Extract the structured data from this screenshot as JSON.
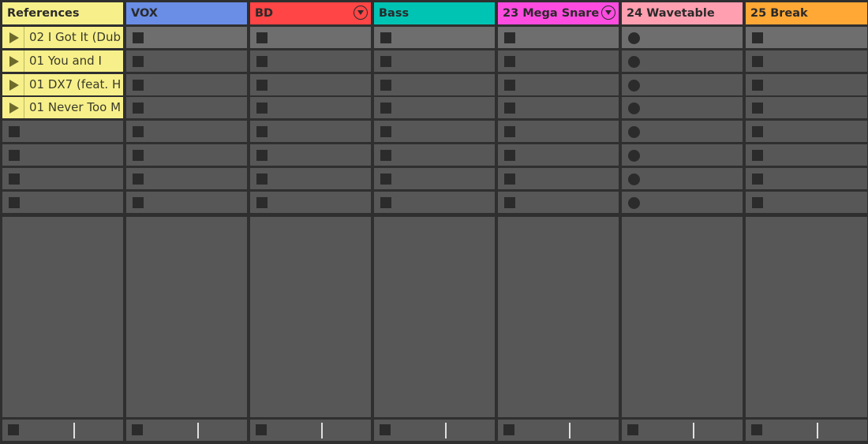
{
  "tracks": [
    {
      "name": "References",
      "color": "#f7f08a",
      "has_menu": false,
      "slot_type": "clip",
      "clips": [
        "02 I Got It (Dub",
        "01 You and I",
        "01 DX7 (feat. H",
        "01 Never Too M"
      ]
    },
    {
      "name": "VOX",
      "color": "#6a8de6",
      "has_menu": false,
      "slot_type": "stop"
    },
    {
      "name": "BD",
      "color": "#ff4545",
      "has_menu": true,
      "slot_type": "stop"
    },
    {
      "name": "Bass",
      "color": "#00c4b3",
      "has_menu": false,
      "slot_type": "stop"
    },
    {
      "name": "23 Mega Snare",
      "color": "#ff4ce0",
      "has_menu": true,
      "slot_type": "stop"
    },
    {
      "name": "24 Wavetable",
      "color": "#ff9fb0",
      "has_menu": false,
      "slot_type": "record"
    },
    {
      "name": "25 Break",
      "color": "#ffa835",
      "has_menu": false,
      "slot_type": "stop"
    }
  ],
  "slot_rows": 8
}
